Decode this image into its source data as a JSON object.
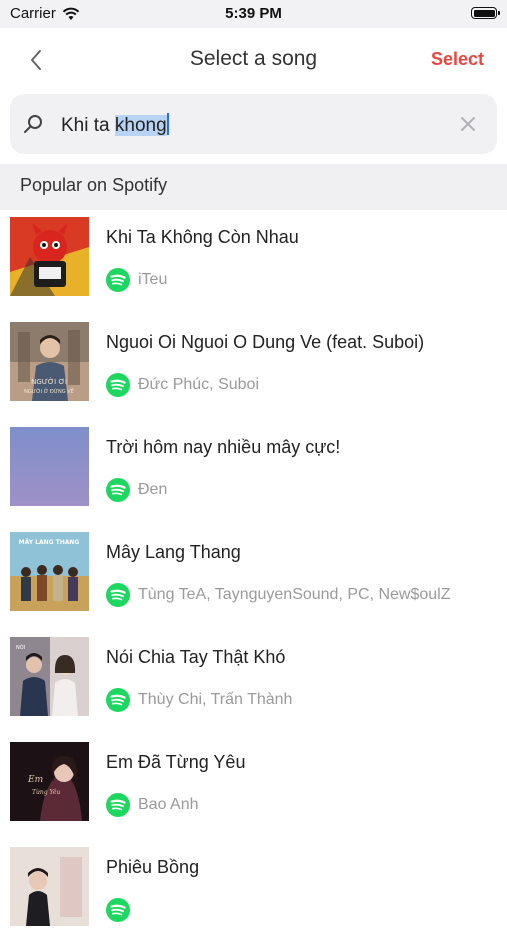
{
  "status_bar": {
    "carrier": "Carrier",
    "time": "5:39 PM"
  },
  "nav": {
    "title": "Select a song",
    "action_label": "Select",
    "action_color": "#e8473f"
  },
  "search": {
    "value_plain": "Khi ta ",
    "value_selected": "khong"
  },
  "section": {
    "label": "Popular on Spotify"
  },
  "songs": [
    {
      "title": "Khi Ta Không Còn Nhau",
      "artist": "iTeu",
      "icon": "spotify-icon"
    },
    {
      "title": "Nguoi Oi Nguoi O Dung Ve (feat. Suboi)",
      "artist": "Đức Phúc, Suboi",
      "icon": "spotify-icon"
    },
    {
      "title": "Trời hôm nay nhiều mây cực!",
      "artist": "Đen",
      "icon": "spotify-icon"
    },
    {
      "title": "Mây Lang Thang",
      "artist": "Tùng TeA, TaynguyenSound, PC, New$oulZ",
      "icon": "spotify-icon"
    },
    {
      "title": "Nói Chia Tay Thật Khó",
      "artist": "Thùy Chi, Trấn Thành",
      "icon": "spotify-icon"
    },
    {
      "title": "Em Đã Từng Yêu",
      "artist": "Bao Anh",
      "icon": "spotify-icon"
    },
    {
      "title": "Phiêu Bồng",
      "artist": "",
      "icon": "spotify-icon"
    }
  ],
  "colors": {
    "spotify_green": "#1ed760",
    "accent_red": "#e8473f"
  }
}
